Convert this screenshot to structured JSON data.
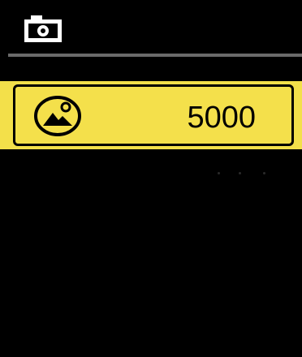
{
  "header": {
    "icon": "camera-icon"
  },
  "menu": {
    "items": [
      {
        "icon": "landscape-icon",
        "value": "5000",
        "selected": true
      }
    ]
  },
  "colors": {
    "background": "#000000",
    "highlight": "#f3e04a",
    "divider": "#6a6a6a",
    "text": "#000000"
  }
}
